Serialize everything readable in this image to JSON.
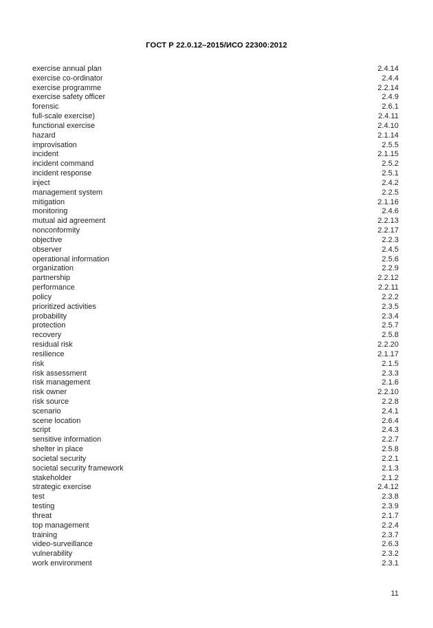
{
  "header": {
    "title": "ГОСТ Р 22.0.12–2015/ИСО 22300:2012"
  },
  "footer": {
    "page_number": "11"
  },
  "index": {
    "entries": [
      {
        "term": "exercise annual plan",
        "ref": "2.4.14"
      },
      {
        "term": "exercise co-ordinator",
        "ref": "2.4.4"
      },
      {
        "term": "exercise programme",
        "ref": "2.2.14"
      },
      {
        "term": "exercise safety officer",
        "ref": "2.4.9"
      },
      {
        "term": "forensic",
        "ref": "2.6.1"
      },
      {
        "term": "full-scale exercise)",
        "ref": "2.4.11"
      },
      {
        "term": "functional exercise",
        "ref": "2.4.10"
      },
      {
        "term": "hazard",
        "ref": "2.1.14"
      },
      {
        "term": "improvisation",
        "ref": "2.5.5"
      },
      {
        "term": "incident",
        "ref": "2.1.15"
      },
      {
        "term": "incident command",
        "ref": "2.5.2"
      },
      {
        "term": "incident response",
        "ref": "2.5.1"
      },
      {
        "term": "inject",
        "ref": "2.4.2"
      },
      {
        "term": "management system",
        "ref": "2.2.5"
      },
      {
        "term": "mitigation",
        "ref": "2.1.16"
      },
      {
        "term": "monitoring",
        "ref": "2.4.6"
      },
      {
        "term": "mutual aid agreement",
        "ref": "2.2.13"
      },
      {
        "term": "nonconformity",
        "ref": "2.2.17"
      },
      {
        "term": "objective",
        "ref": "2.2.3"
      },
      {
        "term": "observer",
        "ref": "2.4.5"
      },
      {
        "term": "operational information",
        "ref": "2.5.6"
      },
      {
        "term": "organization",
        "ref": "2.2.9"
      },
      {
        "term": "partnership",
        "ref": "2.2.12"
      },
      {
        "term": "performance",
        "ref": "2.2.11"
      },
      {
        "term": "policy",
        "ref": "2.2.2"
      },
      {
        "term": "prioritized activities",
        "ref": "2.3.5"
      },
      {
        "term": "probability",
        "ref": "2.3.4"
      },
      {
        "term": "protection",
        "ref": "2.5.7"
      },
      {
        "term": "recovery",
        "ref": "2.5.8"
      },
      {
        "term": "residual risk",
        "ref": "2.2.20"
      },
      {
        "term": "resilience",
        "ref": "2.1.17"
      },
      {
        "term": "risk",
        "ref": "2.1.5"
      },
      {
        "term": "risk assessment",
        "ref": "2.3.3"
      },
      {
        "term": "risk management",
        "ref": "2.1.6"
      },
      {
        "term": "risk owner",
        "ref": "2.2.10"
      },
      {
        "term": "risk source",
        "ref": "2.2.8"
      },
      {
        "term": "scenario",
        "ref": "2.4.1"
      },
      {
        "term": "scene location",
        "ref": "2.6.4"
      },
      {
        "term": "script",
        "ref": "2.4.3"
      },
      {
        "term": "sensitive information",
        "ref": "2.2.7"
      },
      {
        "term": "shelter in place",
        "ref": "2.5.8"
      },
      {
        "term": "societal security",
        "ref": "2.2.1"
      },
      {
        "term": "societal security framework",
        "ref": "2.1.3"
      },
      {
        "term": "stakeholder",
        "ref": "2.1.2"
      },
      {
        "term": "strategic exercise",
        "ref": "2.4.12"
      },
      {
        "term": "test",
        "ref": "2.3.8"
      },
      {
        "term": "testing",
        "ref": "2.3.9"
      },
      {
        "term": "threat",
        "ref": "2.1.7"
      },
      {
        "term": "top management",
        "ref": "2.2.4"
      },
      {
        "term": "training",
        "ref": "2.3.7"
      },
      {
        "term": "video-surveillance",
        "ref": "2.6.3"
      },
      {
        "term": "vulnerability",
        "ref": "2.3.2"
      },
      {
        "term": "work environment",
        "ref": "2.3.1"
      }
    ]
  }
}
